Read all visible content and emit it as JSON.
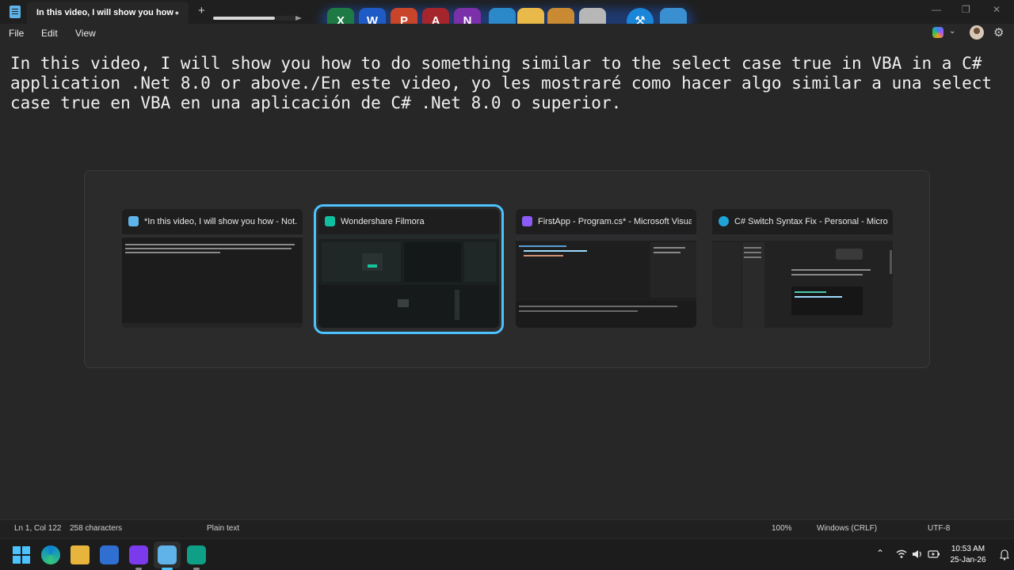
{
  "window": {
    "tab_title": "In this video, I will show you how",
    "tab_modified": "●",
    "new_tab": "+",
    "minimize": "—",
    "maximize": "❐",
    "close": "✕"
  },
  "menu": {
    "items": [
      "File",
      "Edit",
      "View"
    ],
    "copilot_chevron": "⌄",
    "settings_glyph": "⚙"
  },
  "dock": {
    "icons": [
      {
        "name": "excel-icon",
        "letter": "X",
        "color": "#1d7a44"
      },
      {
        "name": "word-icon",
        "letter": "W",
        "color": "#1e5bc6"
      },
      {
        "name": "powerpoint-icon",
        "letter": "P",
        "color": "#c8452a"
      },
      {
        "name": "access-icon",
        "letter": "A",
        "color": "#a4262c"
      },
      {
        "name": "onenote-icon",
        "letter": "N",
        "color": "#7b2fa8"
      },
      {
        "name": "monitor-icon",
        "letter": "",
        "color": "#2b88c9"
      },
      {
        "name": "folder-icon",
        "letter": "",
        "color": "#e9b949"
      },
      {
        "name": "ladder-icon",
        "letter": "",
        "color": "#c98a32"
      },
      {
        "name": "tools-icon",
        "letter": "",
        "color": "#b7b7b7"
      },
      {
        "name": "hammer-wrench-icon",
        "letter": "⚒",
        "color": "#1a86d9"
      },
      {
        "name": "recycle-bin-icon",
        "letter": "",
        "color": "#3a8fd0"
      }
    ]
  },
  "editor": {
    "content": "In this video, I will show you how to do something similar to the select case true in VBA in a C# application .Net 8.0 or above./En este video, yo les mostraré como hacer algo similar a una select case true en VBA en una aplicación de C# .Net 8.0 o superior."
  },
  "switcher": {
    "cards": [
      {
        "title": "*In this video, I will show you how - Not...",
        "icon_color": "#5fb3e8",
        "selected": false
      },
      {
        "title": "Wondershare Filmora",
        "icon_color": "#0fbfa0",
        "selected": true
      },
      {
        "title": "FirstApp - Program.cs* - Microsoft Visua...",
        "icon_color": "#8b5cf6",
        "selected": false
      },
      {
        "title": "C# Switch Syntax Fix - Personal - Micros...",
        "icon_color": "#1fa4d8",
        "selected": false
      }
    ]
  },
  "statusbar": {
    "position": "Ln 1, Col 122",
    "characters": "258 characters",
    "format": "Plain text",
    "zoom": "100%",
    "line_ending": "Windows (CRLF)",
    "encoding": "UTF-8"
  },
  "taskbar": {
    "tray_chevron": "⌃",
    "time": "10:53 AM",
    "date": "25-Jan-26"
  },
  "colors": {
    "accent": "#4cc2ff",
    "background": "#272727"
  }
}
